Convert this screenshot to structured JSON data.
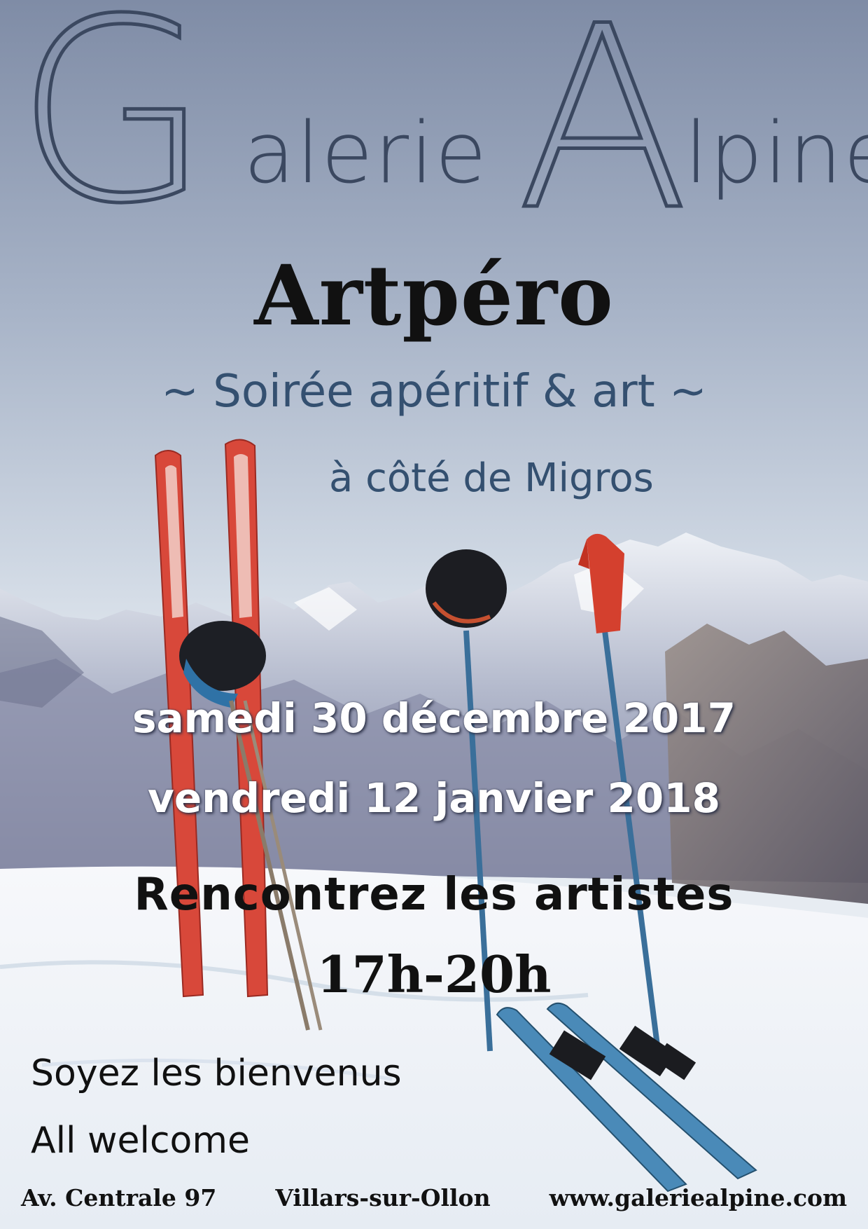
{
  "logo": {
    "text": "Galerie Alpine",
    "letters": [
      "G",
      "alerie",
      "A",
      "lpine"
    ]
  },
  "event": {
    "title": "Artpéro",
    "subtitle": "~ Soirée apéritif & art ~",
    "location": "à côté de Migros",
    "dates": [
      "samedi 30 décembre 2017",
      "vendredi 12 janvier 2018"
    ],
    "tagline": "Rencontrez les artistes",
    "time": "17h-20h"
  },
  "welcome": [
    "Soyez les bienvenus",
    "All welcome"
  ],
  "footer": {
    "address": "Av. Centrale 97",
    "town": "Villars-sur-Ollon",
    "website": "www.galeriealpine.com"
  },
  "colors": {
    "logo": "#3b4860",
    "subtitle": "#345070",
    "ski_red": "#d8483a",
    "ski_blue": "#4a8ab8"
  }
}
